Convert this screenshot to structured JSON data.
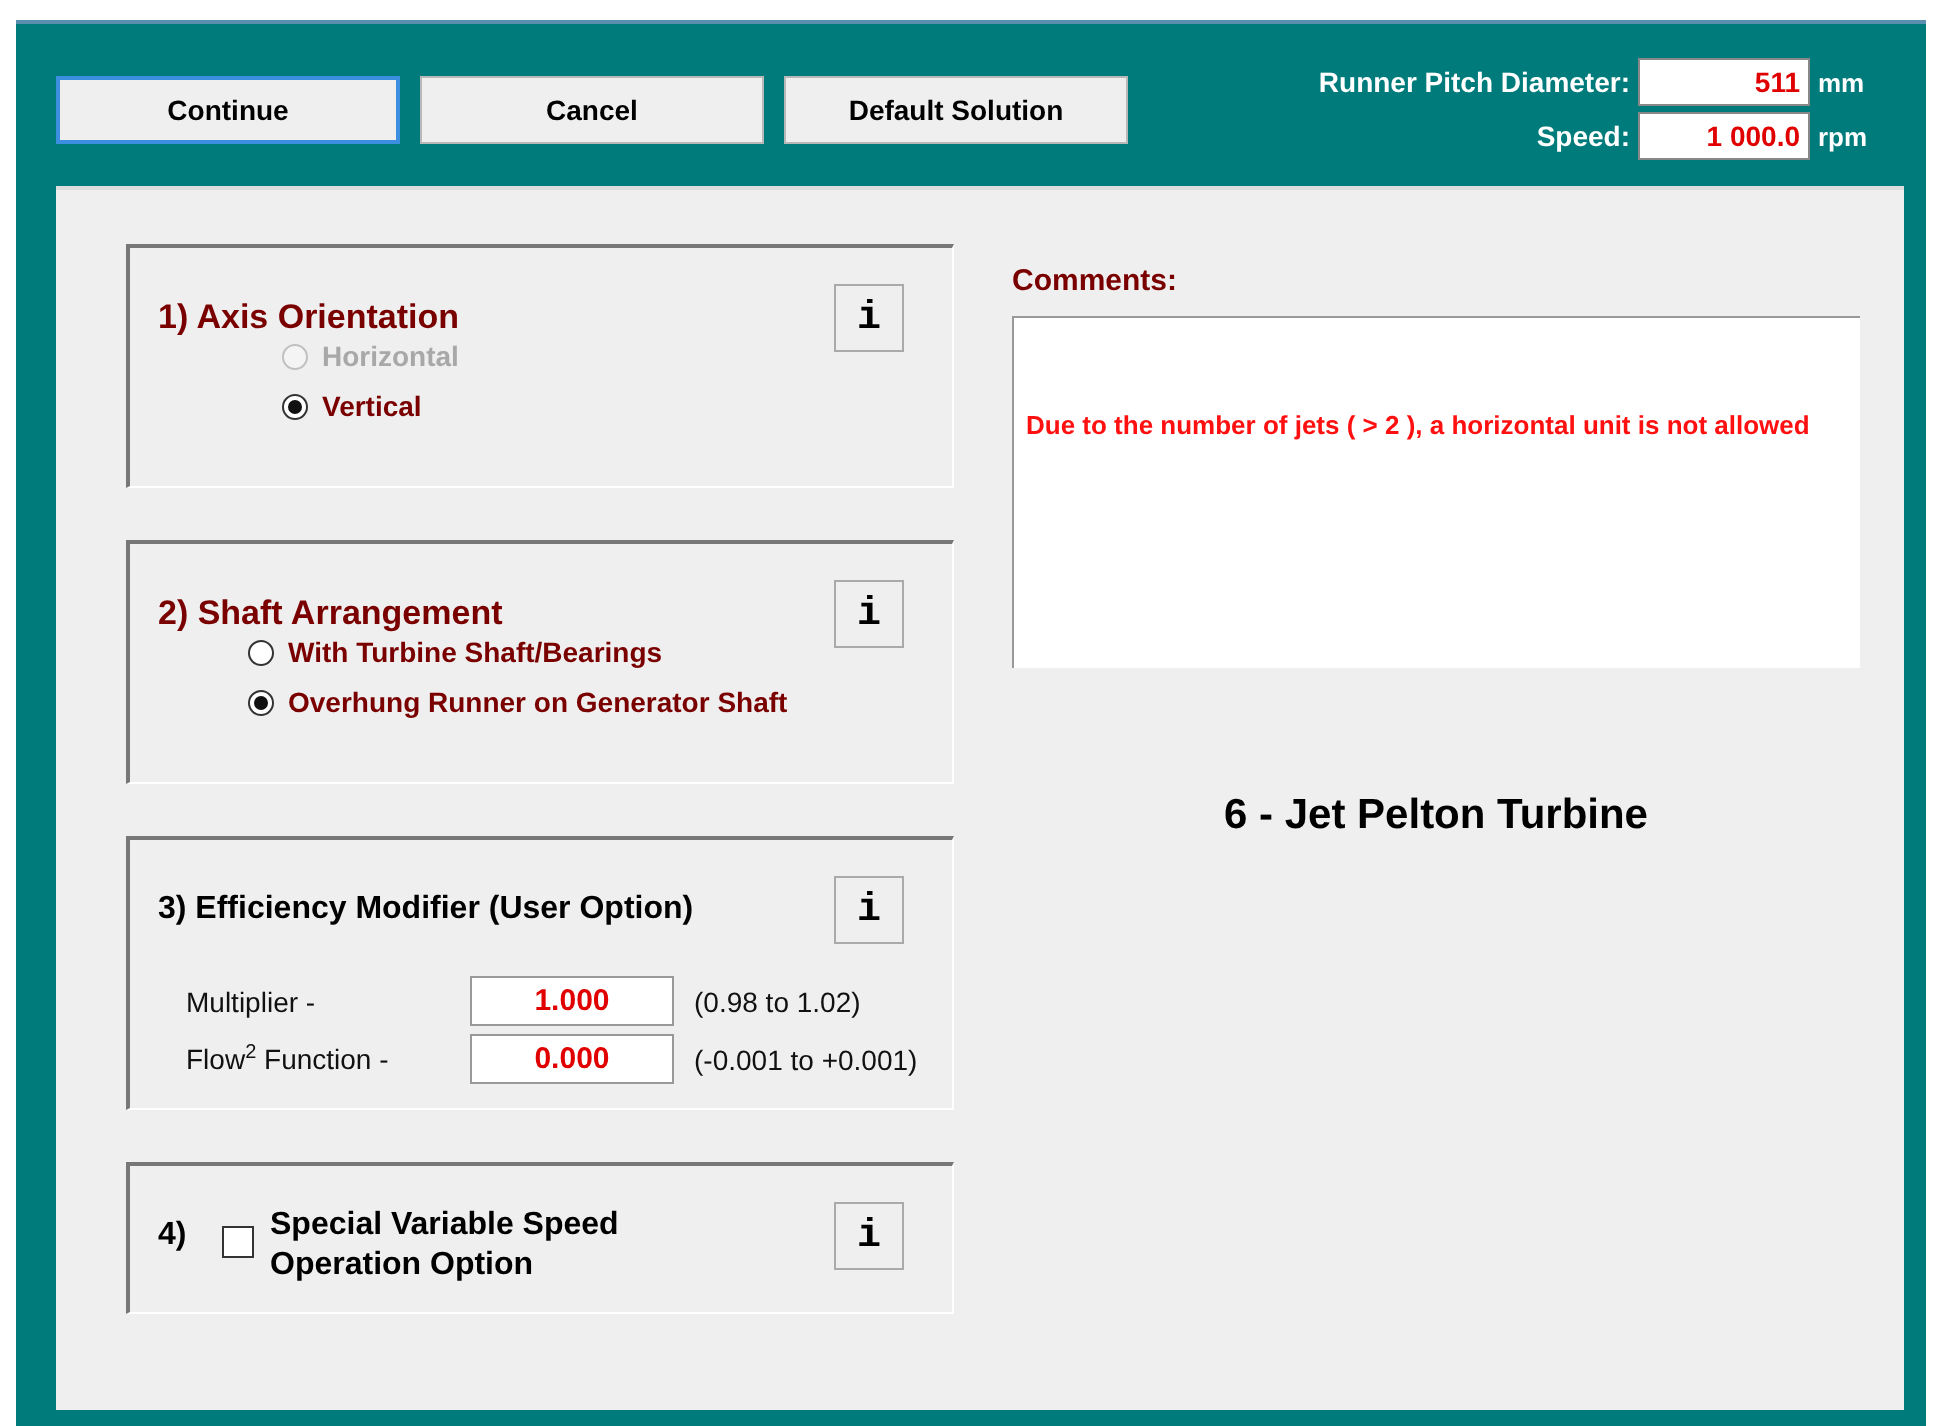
{
  "toolbar": {
    "buttons": [
      {
        "label": "Continue",
        "selected": true
      },
      {
        "label": "Cancel",
        "selected": false
      },
      {
        "label": "Default Solution",
        "selected": false
      }
    ]
  },
  "fields": [
    {
      "label": "Runner Pitch Diameter:",
      "value": "511",
      "unit": "mm"
    },
    {
      "label": "Speed:",
      "value": "1 000.0",
      "unit": "rpm"
    }
  ],
  "sections": [
    {
      "kind": "radio",
      "title": "1) Axis Orientation",
      "info": "i",
      "options": [
        {
          "label": "Horizontal",
          "selected": false,
          "disabled": true
        },
        {
          "label": "Vertical",
          "selected": true,
          "disabled": false
        }
      ]
    },
    {
      "kind": "radio",
      "title": "2) Shaft Arrangement",
      "info": "i",
      "options": [
        {
          "label": "With Turbine Shaft/Bearings",
          "selected": false,
          "disabled": false
        },
        {
          "label": "Overhung Runner on Generator Shaft",
          "selected": true,
          "disabled": false
        }
      ]
    },
    {
      "kind": "modifier",
      "title": "3) Efficiency Modifier (User Option)",
      "info": "i",
      "rows": [
        {
          "label": "Multiplier -",
          "value": "1.000",
          "range": "(0.98 to 1.02)"
        },
        {
          "label": "Flow$^{2}$ Function -",
          "value": "0.000",
          "range": "(-0.001 to +0.001)"
        }
      ]
    },
    {
      "kind": "checkbox",
      "number": "4)",
      "label": "Special Variable Speed Operation Option",
      "checked": false,
      "info": "i"
    }
  ],
  "comments": {
    "label": "Comments:",
    "text": "Due to the number of jets ( > 2 ), a horizontal unit is not allowed"
  },
  "turbine_title": "6 - Jet Pelton Turbine"
}
